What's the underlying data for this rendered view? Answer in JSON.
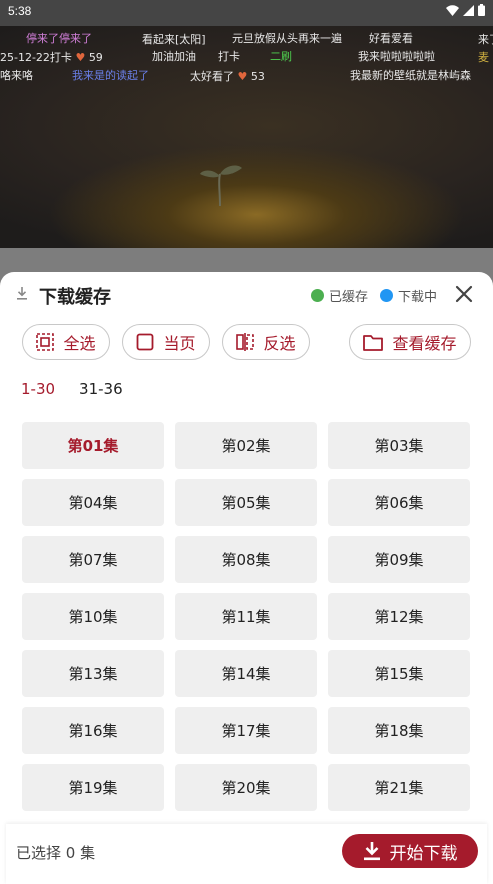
{
  "status_bar": {
    "time": "5:38"
  },
  "danmaku": [
    {
      "text": "停来了停来了",
      "color": "#d17fd9"
    },
    {
      "text": "看起来[太阳]",
      "color": "#e8e8e8"
    },
    {
      "text": "元旦放假从头再来一遍",
      "color": "#e8e8e8"
    },
    {
      "text": "好看爱看",
      "color": "#e8e8e8"
    },
    {
      "text": "来了",
      "color": "#e8e8e8"
    },
    {
      "text": "25-12-22打卡",
      "color": "#e8e8e8",
      "likes": "59"
    },
    {
      "text": "加油加油",
      "color": "#e8e8e8"
    },
    {
      "text": "打卡",
      "color": "#e8e8e8"
    },
    {
      "text": "二刷",
      "color": "#4fd34f"
    },
    {
      "text": "我来啦啦啦啦啦",
      "color": "#e8e8e8"
    },
    {
      "text": "麦",
      "color": "#d0b040"
    },
    {
      "text": "咯来咯",
      "color": "#e8e8e8"
    },
    {
      "text": "我来是的读起了",
      "color": "#6a7fe8"
    },
    {
      "text": "太好看了",
      "color": "#e8e8e8",
      "likes": "53"
    },
    {
      "text": "我最新的壁纸就是林屿森",
      "color": "#e8e8e8"
    }
  ],
  "sheet": {
    "title": "下载缓存",
    "legend": [
      {
        "label": "已缓存",
        "color": "#4caf50"
      },
      {
        "label": "下载中",
        "color": "#2196f3"
      }
    ],
    "actions": {
      "select_all": "全选",
      "current_page": "当页",
      "invert": "反选",
      "view_cache": "查看缓存"
    },
    "range_tabs": [
      {
        "label": "1-30",
        "active": true
      },
      {
        "label": "31-36",
        "active": false
      }
    ],
    "episodes": [
      "第01集",
      "第02集",
      "第03集",
      "第04集",
      "第05集",
      "第06集",
      "第07集",
      "第08集",
      "第09集",
      "第10集",
      "第11集",
      "第12集",
      "第13集",
      "第14集",
      "第15集",
      "第16集",
      "第17集",
      "第18集",
      "第19集",
      "第20集",
      "第21集"
    ],
    "selected_episode": "第01集",
    "footer": {
      "selected_count": "已选择 0 集",
      "start_button": "开始下载"
    }
  },
  "colors": {
    "accent": "#a51b2c"
  }
}
